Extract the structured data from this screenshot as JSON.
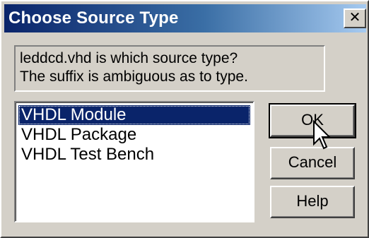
{
  "window": {
    "title": "Choose Source Type",
    "close_glyph": "✕"
  },
  "message": {
    "line1": "leddcd.vhd is which source type?",
    "line2": "The suffix is ambiguous as to type."
  },
  "listbox": {
    "items": [
      "VHDL Module",
      "VHDL Package",
      "VHDL Test Bench"
    ],
    "selected_index": 0
  },
  "buttons": {
    "ok": "OK",
    "cancel": "Cancel",
    "help": "Help"
  },
  "colors": {
    "title_start": "#0a246a",
    "title_end": "#a6caf0",
    "selection": "#0a246a",
    "face": "#d4d0c8"
  },
  "icons": {
    "cursor": "arrow-cursor-icon",
    "close": "close-icon"
  }
}
